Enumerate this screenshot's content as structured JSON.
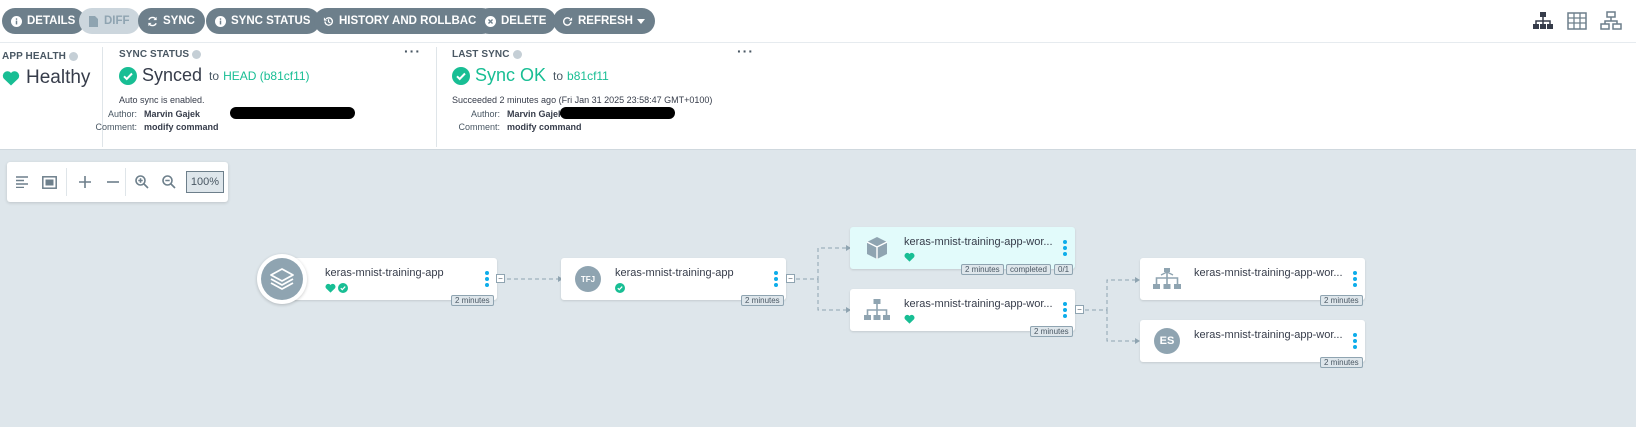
{
  "toolbar": {
    "buttons": [
      {
        "label": "DETAILS",
        "icon": "info-circle-icon"
      },
      {
        "label": "DIFF",
        "icon": "file-icon"
      },
      {
        "label": "SYNC",
        "icon": "sync-icon"
      },
      {
        "label": "SYNC STATUS",
        "icon": "info-circle-icon"
      },
      {
        "label": "HISTORY AND ROLLBACK",
        "icon": "history-icon"
      },
      {
        "label": "DELETE",
        "icon": "times-circle-icon"
      },
      {
        "label": "REFRESH",
        "icon": "redo-icon"
      }
    ],
    "view_icons": [
      "tree-view-icon",
      "list-view-icon",
      "network-view-icon"
    ]
  },
  "app_health": {
    "title": "APP HEALTH",
    "status": "Healthy",
    "icon": "heart-icon"
  },
  "sync_status": {
    "title": "SYNC STATUS",
    "status": "Synced",
    "to": "to",
    "revision": "HEAD (b81cf11)",
    "auto_sync": "Auto sync is enabled.",
    "author_label": "Author:",
    "author": "Marvin Gajek",
    "comment_label": "Comment:",
    "comment": "modify command"
  },
  "last_sync": {
    "title": "LAST SYNC",
    "status": "Sync OK",
    "to": "to",
    "revision": "b81cf11",
    "succeeded": "Succeeded 2 minutes ago (Fri Jan 31 2025 23:58:47 GMT+0100)",
    "author_label": "Author:",
    "author": "Marvin Gajek",
    "comment_label": "Comment:",
    "comment": "modify command"
  },
  "graph_controls": {
    "zoom": "100%",
    "icons": [
      "align-left-icon",
      "fit-screen-icon",
      "plus-icon",
      "minus-icon",
      "zoom-in-icon",
      "zoom-out-icon"
    ]
  },
  "nodes": {
    "app": {
      "name": "keras-mnist-training-app",
      "age": "2 minutes",
      "icon": "layers-icon"
    },
    "tfjob": {
      "name": "keras-mnist-training-app",
      "kind": "tfjob",
      "badge": "TFJ",
      "age": "2 minutes"
    },
    "pod": {
      "name": "keras-mnist-training-app-wor...",
      "kind": "pod",
      "age": "2 minutes",
      "phase": "completed",
      "ready": "0/1",
      "icon": "cube-icon"
    },
    "svc": {
      "name": "keras-mnist-training-app-wor...",
      "kind": "svc",
      "age": "2 minutes",
      "icon": "network-icon"
    },
    "ep": {
      "name": "keras-mnist-training-app-wor...",
      "kind": "ep",
      "age": "2 minutes",
      "icon": "endpoints-icon"
    },
    "endpointslice": {
      "name": "keras-mnist-training-app-wor...",
      "kind": "endpointslice",
      "badge": "ES",
      "age": "2 minutes"
    }
  },
  "colors": {
    "accent": "#18be94",
    "button": "#6d7f8b",
    "link": "#0dadea",
    "pod_bg": "#e2fbfb"
  }
}
